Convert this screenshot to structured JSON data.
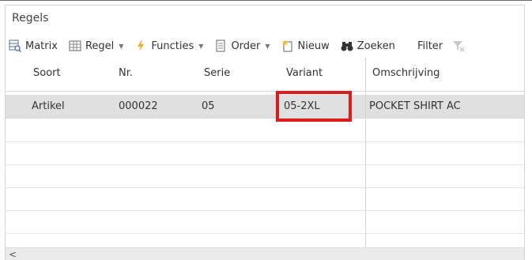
{
  "panel": {
    "title": "Regels"
  },
  "toolbar": {
    "matrix": "Matrix",
    "regel": "Regel",
    "functies": "Functies",
    "order": "Order",
    "nieuw": "Nieuw",
    "zoeken": "Zoeken",
    "filter": "Filter"
  },
  "columns": {
    "soort": "Soort",
    "nr": "Nr.",
    "serie": "Serie",
    "variant": "Variant",
    "omschrijving": "Omschrijving"
  },
  "rows": [
    {
      "soort": "Artikel",
      "nr": "000022",
      "serie": "05",
      "variant": "05-2XL",
      "omschrijving": "POCKET SHIRT AC"
    }
  ],
  "scroll": {
    "left_arrow": "<"
  },
  "colors": {
    "highlight": "#e01b1b",
    "selected_row": "#e0e0e0",
    "functies_icon": "#f5a623"
  }
}
